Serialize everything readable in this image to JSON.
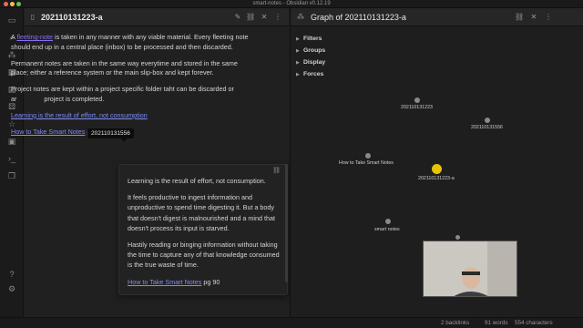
{
  "app": {
    "title": "smart-notes - Obsidian v0.12.19"
  },
  "ribbon": {
    "icons": [
      "folder-icon",
      "search-icon",
      "graph-icon",
      "calendar-icon",
      "template-icon",
      "dice-icon",
      "star-icon",
      "command-icon",
      "terminal-icon",
      "copy-icon",
      "help-icon",
      "settings-icon"
    ]
  },
  "left_pane": {
    "title": "202110131223-a",
    "paragraphs": [
      {
        "prefix": "A ",
        "link": "fleeting-note",
        "suffix": " is taken in any manner with any viable material. Every fleeting note should end up in a central place (inbox) to be processed and then discarded."
      },
      {
        "text": "Permanent notes are taken in the same way everytime and stored in the same place; either a reference system or the main slip-box and kept forever."
      },
      {
        "prefix": "Project notes are kept within a project specific folder taht can be discarded or ar",
        "suffix": " project is completed."
      }
    ],
    "link_line": "Learning is the result of effort, not consumption",
    "source_link": "How to Take Smart Notes",
    "source_suffix": " p",
    "tooltip": "202110131556"
  },
  "popover": {
    "paragraphs": [
      "Learning is the result of effort, not consumption.",
      "It feels productive to ingest information and unproductive to spend time digesting it. But a body that doesn't digest is malnourished and a mind that doesn't process its input is starved.",
      "Hastily reading or binging information without taking the time to capture any of that knowledge consumed is the true waste of time."
    ],
    "source_link": "How to Take Smart Notes",
    "source_suffix": " pg 90"
  },
  "right_pane": {
    "title": "Graph of 202110131223-a",
    "menu": [
      "Filters",
      "Groups",
      "Display",
      "Forces"
    ],
    "nodes": [
      {
        "label": "202110131223",
        "active": false
      },
      {
        "label": "202110131556",
        "active": false
      },
      {
        "label": "How to Take Smart Notes",
        "active": false
      },
      {
        "label": "202110131223-a",
        "active": true
      },
      {
        "label": "smart notes",
        "active": false
      }
    ],
    "active_color": "#e8c400"
  },
  "status": {
    "backlinks": "2 backlinks",
    "words": "91 words",
    "characters": "554 characters"
  },
  "colors": {
    "accent": "#7f6df2",
    "background": "#1e1e1e"
  }
}
